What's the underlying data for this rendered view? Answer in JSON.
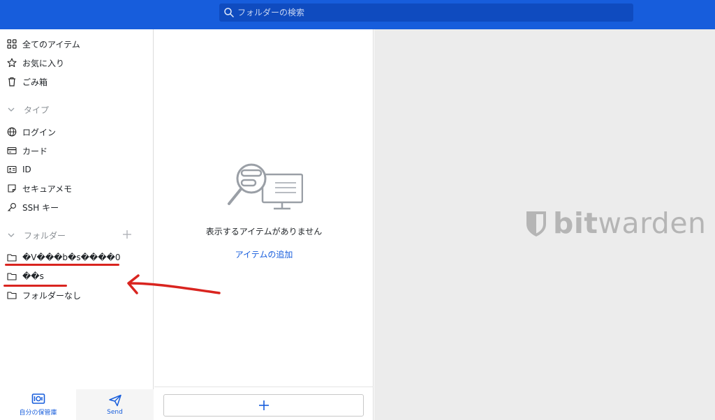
{
  "search": {
    "placeholder": "フォルダーの検索"
  },
  "sidebar": {
    "main_items": [
      {
        "label": "全てのアイテム",
        "icon": "grid-icon"
      },
      {
        "label": "お気に入り",
        "icon": "star-icon"
      },
      {
        "label": "ごみ箱",
        "icon": "trash-icon"
      }
    ],
    "type_section": {
      "title": "タイプ",
      "items": [
        {
          "label": "ログイン",
          "icon": "globe-icon"
        },
        {
          "label": "カード",
          "icon": "credit-card-icon"
        },
        {
          "label": "ID",
          "icon": "id-card-icon"
        },
        {
          "label": "セキュアメモ",
          "icon": "note-icon"
        },
        {
          "label": "SSH キー",
          "icon": "key-icon"
        }
      ]
    },
    "folder_section": {
      "title": "フォルダー",
      "items": [
        {
          "label": "�V���b�s����0",
          "icon": "folder-icon"
        },
        {
          "label": "��s",
          "icon": "folder-icon"
        },
        {
          "label": "フォルダーなし",
          "icon": "folder-icon"
        }
      ]
    }
  },
  "bottom_nav": {
    "vault_label": "自分の保管庫",
    "send_label": "Send"
  },
  "list": {
    "empty_text": "表示するアイテムがありません",
    "add_link": "アイテムの追加"
  },
  "logo": {
    "bold": "bit",
    "light": "warden"
  },
  "colors": {
    "brand": "#175ddc",
    "annotation": "#d9241f"
  }
}
